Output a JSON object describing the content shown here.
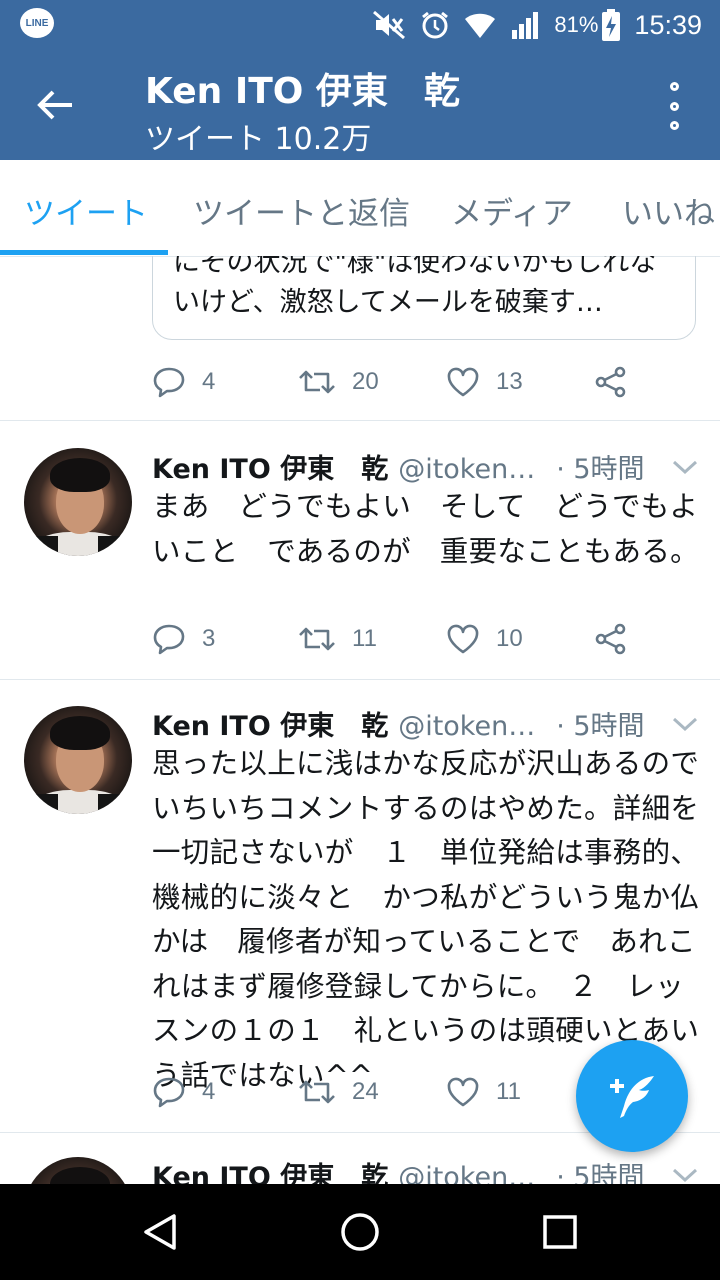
{
  "status_bar": {
    "app_icon_label": "LINE",
    "battery": "81%",
    "time": "15:39"
  },
  "app_bar": {
    "title": "Ken ITO 伊東　乾",
    "subtitle": "ツイート 10.2万"
  },
  "tabs": [
    {
      "label": "ツイート",
      "active": true
    },
    {
      "label": "ツイートと返信",
      "active": false
    },
    {
      "label": "メディア",
      "active": false
    },
    {
      "label": "いいね",
      "active": false
    }
  ],
  "top_tweet": {
    "quoted_text": "にその状況で\"様\"は使わないかもしれないけど、激怒してメールを破棄す…",
    "replies": "4",
    "retweets": "20",
    "likes": "13"
  },
  "tweets": [
    {
      "name": "Ken ITO 伊東　乾",
      "handle": "@itokenst...",
      "time": "· 5時間",
      "text": "まあ　どうでもよい　そして　どうでもよいこと　であるのが　重要なこともある。",
      "replies": "3",
      "retweets": "11",
      "likes": "10"
    },
    {
      "name": "Ken ITO 伊東　乾",
      "handle": "@itokenst...",
      "time": "· 5時間",
      "text": "思った以上に浅はかな反応が沢山あるのでいちいちコメントするのはやめた。詳細を一切記さないが　１　単位発給は事務的、機械的に淡々と　かつ私がどういう鬼か仏かは　履修者が知っていることで　あれこれはまず履修登録してからに。　２　レッスンの１の１　礼というのは頭硬いとあいう話ではない^^",
      "replies": "4",
      "retweets": "24",
      "likes": "11"
    },
    {
      "name": "Ken ITO 伊東　乾",
      "handle": "@itokenst...",
      "time": "· 5時間"
    }
  ],
  "colors": {
    "app_bar": "#3b6aa0",
    "accent": "#1da1f2",
    "secondary_text": "#657786"
  }
}
